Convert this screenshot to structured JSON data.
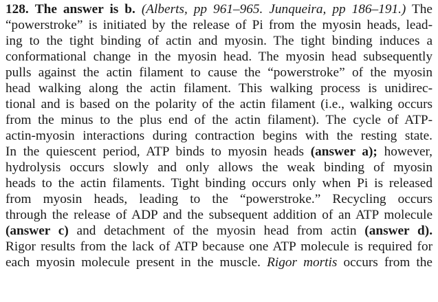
{
  "question_number": "128.",
  "lead": "The answer is b.",
  "citation": "(Alberts, pp 961–965. Junqueira, pp 186–191.)",
  "lines": {
    "l1_tail": "The",
    "l2": "“powerstroke” is initiated by the release of Pi from the myosin heads, lead-",
    "l3": "ing to the tight binding of actin and myosin. The tight binding induces a",
    "l4": "conformational change in the myosin head. The myosin head subsequently",
    "l5": "pulls against the actin filament to cause the “powerstroke” of the myosin",
    "l6": "head walking along the actin filament. This walking process is unidirec-",
    "l7": "tional and is based on the polarity of the actin filament (i.e., walking occurs",
    "l8": "from the minus to the plus end of the actin filament). The cycle of ATP-",
    "l9": "actin-myosin interactions during contraction begins with the resting state.",
    "l10_a": "In the quiescent period, ATP binds to myosin heads",
    "l10_b": "(answer a);",
    "l10_c": "however,",
    "l11": "hydrolysis occurs slowly and only allows the weak binding of myosin",
    "l12": "heads to the actin filaments. Tight binding occurs only when Pi is released",
    "l13": "from myosin heads, leading to the “powerstroke.” Recycling occurs",
    "l14": "through the release of ADP and the subsequent addition of an ATP molecule",
    "l15_a": "(answer c)",
    "l15_b": "and detachment of the myosin head from actin",
    "l15_c": "(answer d).",
    "l16": "Rigor results from the lack of ATP because one ATP molecule is required for",
    "l17_a": "each myosin molecule present in the muscle.",
    "l17_b": "Rigor mortis",
    "l17_c": "occurs from the"
  }
}
